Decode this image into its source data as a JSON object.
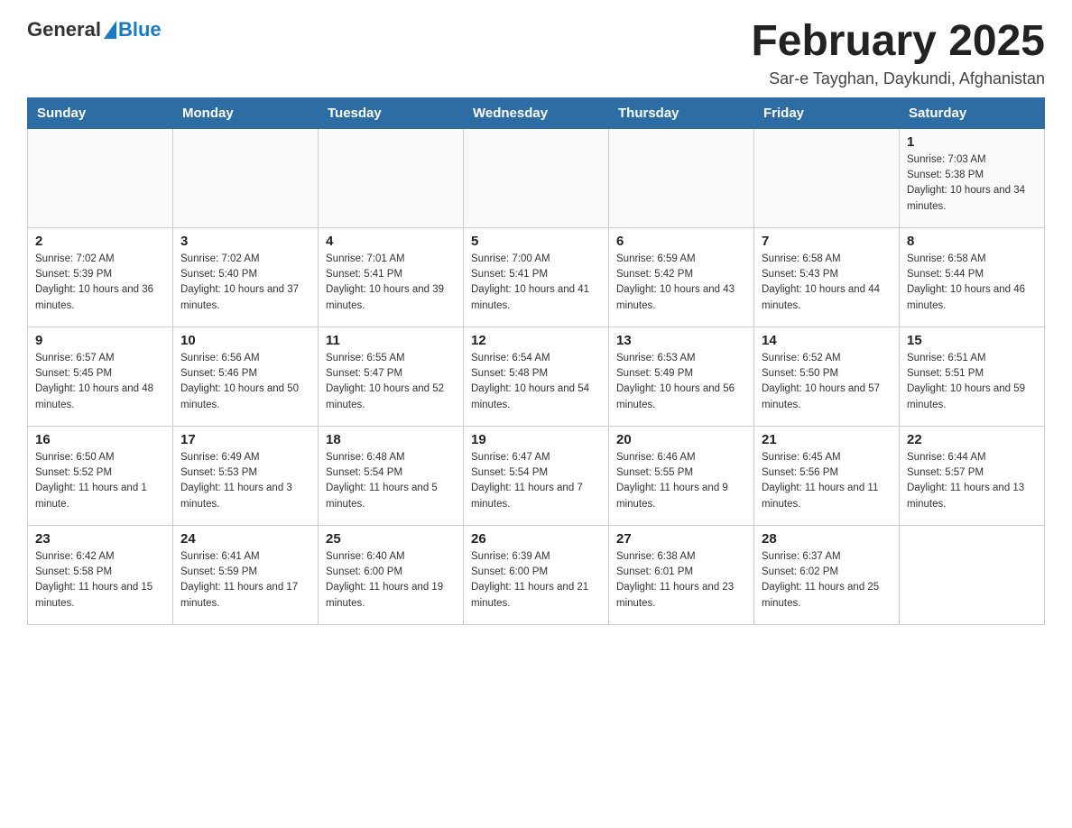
{
  "header": {
    "logo_general": "General",
    "logo_blue": "Blue",
    "title": "February 2025",
    "subtitle": "Sar-e Tayghan, Daykundi, Afghanistan"
  },
  "days_of_week": [
    "Sunday",
    "Monday",
    "Tuesday",
    "Wednesday",
    "Thursday",
    "Friday",
    "Saturday"
  ],
  "weeks": [
    [
      {
        "day": "",
        "sunrise": "",
        "sunset": "",
        "daylight": ""
      },
      {
        "day": "",
        "sunrise": "",
        "sunset": "",
        "daylight": ""
      },
      {
        "day": "",
        "sunrise": "",
        "sunset": "",
        "daylight": ""
      },
      {
        "day": "",
        "sunrise": "",
        "sunset": "",
        "daylight": ""
      },
      {
        "day": "",
        "sunrise": "",
        "sunset": "",
        "daylight": ""
      },
      {
        "day": "",
        "sunrise": "",
        "sunset": "",
        "daylight": ""
      },
      {
        "day": "1",
        "sunrise": "Sunrise: 7:03 AM",
        "sunset": "Sunset: 5:38 PM",
        "daylight": "Daylight: 10 hours and 34 minutes."
      }
    ],
    [
      {
        "day": "2",
        "sunrise": "Sunrise: 7:02 AM",
        "sunset": "Sunset: 5:39 PM",
        "daylight": "Daylight: 10 hours and 36 minutes."
      },
      {
        "day": "3",
        "sunrise": "Sunrise: 7:02 AM",
        "sunset": "Sunset: 5:40 PM",
        "daylight": "Daylight: 10 hours and 37 minutes."
      },
      {
        "day": "4",
        "sunrise": "Sunrise: 7:01 AM",
        "sunset": "Sunset: 5:41 PM",
        "daylight": "Daylight: 10 hours and 39 minutes."
      },
      {
        "day": "5",
        "sunrise": "Sunrise: 7:00 AM",
        "sunset": "Sunset: 5:41 PM",
        "daylight": "Daylight: 10 hours and 41 minutes."
      },
      {
        "day": "6",
        "sunrise": "Sunrise: 6:59 AM",
        "sunset": "Sunset: 5:42 PM",
        "daylight": "Daylight: 10 hours and 43 minutes."
      },
      {
        "day": "7",
        "sunrise": "Sunrise: 6:58 AM",
        "sunset": "Sunset: 5:43 PM",
        "daylight": "Daylight: 10 hours and 44 minutes."
      },
      {
        "day": "8",
        "sunrise": "Sunrise: 6:58 AM",
        "sunset": "Sunset: 5:44 PM",
        "daylight": "Daylight: 10 hours and 46 minutes."
      }
    ],
    [
      {
        "day": "9",
        "sunrise": "Sunrise: 6:57 AM",
        "sunset": "Sunset: 5:45 PM",
        "daylight": "Daylight: 10 hours and 48 minutes."
      },
      {
        "day": "10",
        "sunrise": "Sunrise: 6:56 AM",
        "sunset": "Sunset: 5:46 PM",
        "daylight": "Daylight: 10 hours and 50 minutes."
      },
      {
        "day": "11",
        "sunrise": "Sunrise: 6:55 AM",
        "sunset": "Sunset: 5:47 PM",
        "daylight": "Daylight: 10 hours and 52 minutes."
      },
      {
        "day": "12",
        "sunrise": "Sunrise: 6:54 AM",
        "sunset": "Sunset: 5:48 PM",
        "daylight": "Daylight: 10 hours and 54 minutes."
      },
      {
        "day": "13",
        "sunrise": "Sunrise: 6:53 AM",
        "sunset": "Sunset: 5:49 PM",
        "daylight": "Daylight: 10 hours and 56 minutes."
      },
      {
        "day": "14",
        "sunrise": "Sunrise: 6:52 AM",
        "sunset": "Sunset: 5:50 PM",
        "daylight": "Daylight: 10 hours and 57 minutes."
      },
      {
        "day": "15",
        "sunrise": "Sunrise: 6:51 AM",
        "sunset": "Sunset: 5:51 PM",
        "daylight": "Daylight: 10 hours and 59 minutes."
      }
    ],
    [
      {
        "day": "16",
        "sunrise": "Sunrise: 6:50 AM",
        "sunset": "Sunset: 5:52 PM",
        "daylight": "Daylight: 11 hours and 1 minute."
      },
      {
        "day": "17",
        "sunrise": "Sunrise: 6:49 AM",
        "sunset": "Sunset: 5:53 PM",
        "daylight": "Daylight: 11 hours and 3 minutes."
      },
      {
        "day": "18",
        "sunrise": "Sunrise: 6:48 AM",
        "sunset": "Sunset: 5:54 PM",
        "daylight": "Daylight: 11 hours and 5 minutes."
      },
      {
        "day": "19",
        "sunrise": "Sunrise: 6:47 AM",
        "sunset": "Sunset: 5:54 PM",
        "daylight": "Daylight: 11 hours and 7 minutes."
      },
      {
        "day": "20",
        "sunrise": "Sunrise: 6:46 AM",
        "sunset": "Sunset: 5:55 PM",
        "daylight": "Daylight: 11 hours and 9 minutes."
      },
      {
        "day": "21",
        "sunrise": "Sunrise: 6:45 AM",
        "sunset": "Sunset: 5:56 PM",
        "daylight": "Daylight: 11 hours and 11 minutes."
      },
      {
        "day": "22",
        "sunrise": "Sunrise: 6:44 AM",
        "sunset": "Sunset: 5:57 PM",
        "daylight": "Daylight: 11 hours and 13 minutes."
      }
    ],
    [
      {
        "day": "23",
        "sunrise": "Sunrise: 6:42 AM",
        "sunset": "Sunset: 5:58 PM",
        "daylight": "Daylight: 11 hours and 15 minutes."
      },
      {
        "day": "24",
        "sunrise": "Sunrise: 6:41 AM",
        "sunset": "Sunset: 5:59 PM",
        "daylight": "Daylight: 11 hours and 17 minutes."
      },
      {
        "day": "25",
        "sunrise": "Sunrise: 6:40 AM",
        "sunset": "Sunset: 6:00 PM",
        "daylight": "Daylight: 11 hours and 19 minutes."
      },
      {
        "day": "26",
        "sunrise": "Sunrise: 6:39 AM",
        "sunset": "Sunset: 6:00 PM",
        "daylight": "Daylight: 11 hours and 21 minutes."
      },
      {
        "day": "27",
        "sunrise": "Sunrise: 6:38 AM",
        "sunset": "Sunset: 6:01 PM",
        "daylight": "Daylight: 11 hours and 23 minutes."
      },
      {
        "day": "28",
        "sunrise": "Sunrise: 6:37 AM",
        "sunset": "Sunset: 6:02 PM",
        "daylight": "Daylight: 11 hours and 25 minutes."
      },
      {
        "day": "",
        "sunrise": "",
        "sunset": "",
        "daylight": ""
      }
    ]
  ]
}
